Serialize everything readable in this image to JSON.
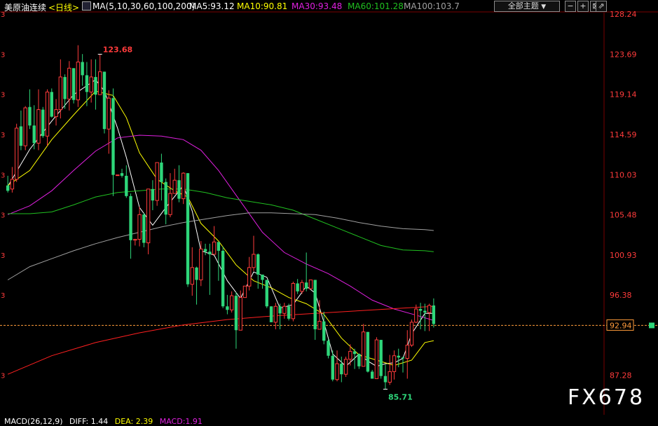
{
  "header": {
    "instrument": "美原油连续",
    "period": "<日线>",
    "ma_set": "MA(5,10,30,60,100,200)",
    "ma5": "MA5:93.12",
    "ma10": "MA10:90.81",
    "ma30": "MA30:93.48",
    "ma60": "MA60:101.28",
    "ma100": "MA100:103.7",
    "theme_button": "全部主题",
    "theme_arrow": "▼"
  },
  "colors": {
    "background": "#000000",
    "up": "#ff3b3b",
    "down": "#2ed67a",
    "ma5": "#ffffff",
    "ma10": "#ffff00",
    "ma30": "#e020e0",
    "ma60": "#20c020",
    "ma100": "#a0a0a0",
    "ma200": "#ff2020",
    "axis_text": "#ff3b3b",
    "current_line": "#ff9b3b"
  },
  "watermark": "FX678",
  "footer": {
    "macd": "MACD(26,12,9)",
    "diff": "DIFF: 1.44",
    "dea": "DEA: 2.39",
    "macd_val": "MACD:1.91"
  },
  "chart_data": {
    "type": "candlestick",
    "ylim": [
      84.0,
      129.5
    ],
    "y_ticks": [
      "128.24",
      "123.69",
      "119.14",
      "114.59",
      "110.03",
      "105.48",
      "100.93",
      "96.38",
      "92.94",
      "87.28"
    ],
    "current_price": "92.94",
    "annotations": [
      {
        "text": "123.68",
        "index": 21,
        "value": 123.68,
        "kind": "high"
      },
      {
        "text": "85.71",
        "index": 86,
        "value": 85.71,
        "kind": "low"
      }
    ],
    "candles": [
      [
        108.8,
        108.2,
        109.9,
        108.0
      ],
      [
        108.4,
        109.5,
        110.9,
        108.0
      ],
      [
        109.5,
        115.3,
        115.8,
        109.2
      ],
      [
        115.5,
        113.3,
        117.3,
        112.8
      ],
      [
        113.3,
        117.6,
        117.8,
        112.8
      ],
      [
        117.7,
        115.6,
        119.7,
        115.2
      ],
      [
        115.6,
        113.6,
        117.9,
        112.9
      ],
      [
        113.6,
        117.4,
        119.7,
        112.8
      ],
      [
        117.4,
        114.4,
        117.7,
        114.2
      ],
      [
        114.4,
        119.4,
        119.7,
        113.3
      ],
      [
        119.4,
        116.6,
        119.8,
        116.5
      ],
      [
        116.6,
        117.4,
        118.6,
        115.6
      ],
      [
        117.4,
        121.1,
        123.1,
        116.4
      ],
      [
        121.1,
        118.6,
        121.4,
        117.5
      ],
      [
        118.6,
        122.1,
        122.9,
        117.3
      ],
      [
        122.1,
        118.5,
        122.1,
        118.1
      ],
      [
        118.5,
        122.8,
        124.7,
        117.7
      ],
      [
        122.8,
        121.3,
        123.7,
        120.1
      ],
      [
        121.3,
        119.4,
        122.8,
        117.8
      ],
      [
        119.4,
        121.1,
        123.1,
        118.2
      ],
      [
        121.1,
        119.1,
        123.1,
        117.4
      ],
      [
        119.1,
        121.7,
        123.7,
        119.1
      ],
      [
        121.7,
        115.2,
        121.7,
        114.7
      ],
      [
        115.2,
        118.7,
        119.6,
        112.4
      ],
      [
        118.7,
        110.0,
        119.8,
        107.6
      ],
      [
        110.0,
        110.0,
        110.0,
        110.0
      ],
      [
        110.2,
        109.9,
        110.7,
        109.7
      ],
      [
        109.9,
        107.6,
        111.1,
        107.4
      ],
      [
        107.6,
        102.6,
        107.9,
        100.5
      ],
      [
        102.6,
        102.7,
        102.7,
        102.0
      ],
      [
        102.7,
        105.5,
        106.4,
        101.9
      ],
      [
        105.5,
        102.3,
        105.7,
        101.8
      ],
      [
        102.3,
        108.4,
        108.4,
        101.0
      ],
      [
        108.4,
        107.1,
        109.4,
        106.0
      ],
      [
        107.1,
        111.4,
        111.4,
        106.5
      ],
      [
        111.4,
        109.2,
        112.4,
        107.1
      ],
      [
        109.2,
        105.5,
        109.6,
        104.4
      ],
      [
        105.5,
        107.9,
        110.2,
        105.2
      ],
      [
        107.9,
        109.4,
        110.7,
        107.9
      ],
      [
        109.4,
        107.3,
        111.1,
        106.9
      ],
      [
        107.3,
        110.2,
        110.3,
        106.7
      ],
      [
        110.2,
        97.6,
        110.2,
        97.3
      ],
      [
        97.6,
        99.5,
        101.8,
        96.3
      ],
      [
        99.5,
        98.1,
        99.6,
        95.3
      ],
      [
        98.1,
        101.6,
        102.5,
        97.4
      ],
      [
        101.6,
        101.3,
        102.2,
        100.9
      ],
      [
        101.3,
        101.0,
        102.2,
        96.4
      ],
      [
        101.0,
        102.4,
        104.2,
        101.0
      ],
      [
        102.4,
        101.4,
        101.9,
        98.0
      ],
      [
        101.4,
        95.1,
        101.9,
        94.9
      ],
      [
        95.1,
        94.7,
        96.4,
        94.2
      ],
      [
        94.7,
        96.3,
        96.8,
        94.4
      ],
      [
        96.3,
        92.4,
        96.7,
        90.3
      ],
      [
        92.4,
        96.1,
        96.9,
        92.4
      ],
      [
        96.1,
        97.4,
        97.4,
        96.1
      ],
      [
        97.4,
        99.5,
        100.7,
        96.9
      ],
      [
        99.5,
        101.0,
        103.1,
        99.1
      ],
      [
        101.0,
        98.7,
        101.1,
        97.1
      ],
      [
        98.7,
        98.1,
        98.1,
        97.1
      ],
      [
        98.1,
        95.1,
        98.1,
        94.9
      ],
      [
        95.1,
        93.3,
        95.1,
        93.3
      ],
      [
        93.3,
        95.1,
        95.5,
        92.5
      ],
      [
        95.1,
        94.3,
        95.4,
        92.5
      ],
      [
        94.3,
        95.1,
        95.5,
        93.7
      ],
      [
        95.1,
        93.7,
        95.4,
        93.5
      ],
      [
        93.7,
        97.7,
        97.9,
        93.4
      ],
      [
        97.7,
        96.8,
        98.2,
        96.5
      ],
      [
        96.8,
        97.8,
        98.1,
        96.5
      ],
      [
        97.8,
        97.1,
        101.2,
        96.8
      ],
      [
        97.1,
        98.1,
        98.1,
        97.0
      ],
      [
        98.1,
        92.5,
        98.1,
        91.3
      ],
      [
        92.5,
        93.4,
        95.8,
        93.4
      ],
      [
        93.4,
        91.2,
        94.5,
        90.8
      ],
      [
        91.2,
        89.5,
        91.4,
        89.2
      ],
      [
        89.5,
        86.8,
        90.1,
        86.6
      ],
      [
        86.8,
        88.6,
        90.1,
        86.6
      ],
      [
        88.6,
        87.4,
        89.4,
        86.5
      ],
      [
        87.4,
        89.1,
        89.4,
        87.1
      ],
      [
        89.1,
        90.0,
        90.8,
        88.4
      ],
      [
        90.0,
        89.7,
        90.3,
        88.0
      ],
      [
        89.7,
        88.3,
        89.7,
        88.0
      ],
      [
        88.3,
        92.2,
        93.1,
        88.3
      ],
      [
        92.2,
        87.7,
        92.2,
        87.6
      ],
      [
        87.7,
        86.9,
        87.9,
        86.9
      ],
      [
        86.9,
        91.3,
        91.6,
        86.9
      ],
      [
        91.3,
        87.2,
        91.3,
        86.9
      ],
      [
        87.2,
        86.5,
        88.5,
        85.7
      ],
      [
        86.5,
        87.7,
        89.6,
        86.2
      ],
      [
        87.7,
        89.5,
        90.1,
        86.8
      ],
      [
        89.5,
        89.3,
        90.3,
        88.2
      ],
      [
        89.3,
        89.2,
        89.4,
        87.6
      ],
      [
        89.2,
        90.7,
        92.4,
        86.9
      ],
      [
        90.7,
        93.3,
        93.6,
        90.5
      ],
      [
        93.3,
        94.8,
        95.3,
        93.2
      ],
      [
        94.8,
        94.6,
        95.5,
        92.5
      ],
      [
        94.6,
        94.4,
        95.4,
        92.3
      ],
      [
        94.4,
        95.2,
        95.4,
        92.3
      ],
      [
        95.2,
        93.1,
        96.0,
        92.7
      ]
    ],
    "ma": {
      "ma5": [
        [
          0,
          108.7
        ],
        [
          5,
          112.9
        ],
        [
          10,
          116.1
        ],
        [
          15,
          119.1
        ],
        [
          20,
          120.8
        ],
        [
          22,
          119.5
        ],
        [
          25,
          115.3
        ],
        [
          27,
          112.0
        ],
        [
          30,
          106.3
        ],
        [
          33,
          104.3
        ],
        [
          36,
          106.3
        ],
        [
          40,
          108.8
        ],
        [
          42,
          105.9
        ],
        [
          44,
          101.4
        ],
        [
          47,
          100.9
        ],
        [
          50,
          98.0
        ],
        [
          53,
          96.0
        ],
        [
          56,
          99.0
        ],
        [
          59,
          98.4
        ],
        [
          62,
          94.9
        ],
        [
          65,
          95.3
        ],
        [
          68,
          97.4
        ],
        [
          70,
          96.6
        ],
        [
          72,
          93.3
        ],
        [
          74,
          89.7
        ],
        [
          77,
          88.3
        ],
        [
          80,
          89.7
        ],
        [
          82,
          88.9
        ],
        [
          84,
          88.3
        ],
        [
          86,
          88.6
        ],
        [
          88,
          88.7
        ],
        [
          90,
          89.2
        ],
        [
          92,
          92.0
        ],
        [
          95,
          94.3
        ],
        [
          97,
          94.3
        ]
      ],
      "ma10": [
        [
          0,
          108.8
        ],
        [
          5,
          110.5
        ],
        [
          10,
          114.0
        ],
        [
          15,
          116.8
        ],
        [
          20,
          119.5
        ],
        [
          24,
          119.0
        ],
        [
          27,
          116.5
        ],
        [
          30,
          112.5
        ],
        [
          34,
          109.5
        ],
        [
          38,
          108.2
        ],
        [
          41,
          107.5
        ],
        [
          44,
          104.5
        ],
        [
          48,
          102.5
        ],
        [
          52,
          99.8
        ],
        [
          56,
          98.0
        ],
        [
          60,
          97.2
        ],
        [
          64,
          96.1
        ],
        [
          68,
          95.4
        ],
        [
          72,
          94.2
        ],
        [
          76,
          91.5
        ],
        [
          80,
          89.6
        ],
        [
          84,
          89.0
        ],
        [
          88,
          88.4
        ],
        [
          92,
          89.0
        ],
        [
          95,
          91.0
        ],
        [
          97,
          91.2
        ]
      ],
      "ma30": [
        [
          0,
          105.5
        ],
        [
          5,
          106.5
        ],
        [
          10,
          108.2
        ],
        [
          15,
          110.5
        ],
        [
          20,
          112.7
        ],
        [
          25,
          114.2
        ],
        [
          30,
          114.5
        ],
        [
          35,
          114.4
        ],
        [
          40,
          114.0
        ],
        [
          44,
          112.8
        ],
        [
          48,
          110.5
        ],
        [
          53,
          107.0
        ],
        [
          58,
          103.5
        ],
        [
          63,
          101.2
        ],
        [
          68,
          99.9
        ],
        [
          73,
          98.8
        ],
        [
          78,
          97.4
        ],
        [
          83,
          95.8
        ],
        [
          88,
          94.8
        ],
        [
          93,
          94.1
        ],
        [
          97,
          93.5
        ]
      ],
      "ma60": [
        [
          0,
          105.6
        ],
        [
          5,
          105.6
        ],
        [
          10,
          105.8
        ],
        [
          15,
          106.6
        ],
        [
          20,
          107.5
        ],
        [
          25,
          108.0
        ],
        [
          30,
          108.2
        ],
        [
          35,
          108.4
        ],
        [
          40,
          108.4
        ],
        [
          45,
          108.0
        ],
        [
          50,
          107.4
        ],
        [
          55,
          107.0
        ],
        [
          60,
          106.6
        ],
        [
          65,
          106.0
        ],
        [
          70,
          105.0
        ],
        [
          75,
          104.0
        ],
        [
          80,
          103.0
        ],
        [
          85,
          102.0
        ],
        [
          90,
          101.5
        ],
        [
          95,
          101.4
        ],
        [
          97,
          101.3
        ]
      ],
      "ma100": [
        [
          0,
          98.1
        ],
        [
          5,
          99.6
        ],
        [
          10,
          100.5
        ],
        [
          15,
          101.4
        ],
        [
          20,
          102.2
        ],
        [
          25,
          102.9
        ],
        [
          30,
          103.5
        ],
        [
          35,
          104.1
        ],
        [
          40,
          104.6
        ],
        [
          45,
          105.0
        ],
        [
          50,
          105.4
        ],
        [
          55,
          105.7
        ],
        [
          60,
          105.7
        ],
        [
          65,
          105.6
        ],
        [
          70,
          105.5
        ],
        [
          75,
          105.1
        ],
        [
          80,
          104.6
        ],
        [
          85,
          104.2
        ],
        [
          90,
          103.9
        ],
        [
          95,
          103.8
        ],
        [
          97,
          103.7
        ]
      ],
      "ma200": [
        [
          0,
          87.4
        ],
        [
          10,
          89.5
        ],
        [
          20,
          91.0
        ],
        [
          30,
          92.1
        ],
        [
          40,
          93.0
        ],
        [
          50,
          93.6
        ],
        [
          60,
          94.0
        ],
        [
          70,
          94.3
        ],
        [
          80,
          94.6
        ],
        [
          90,
          94.9
        ],
        [
          97,
          95.1
        ]
      ]
    }
  }
}
